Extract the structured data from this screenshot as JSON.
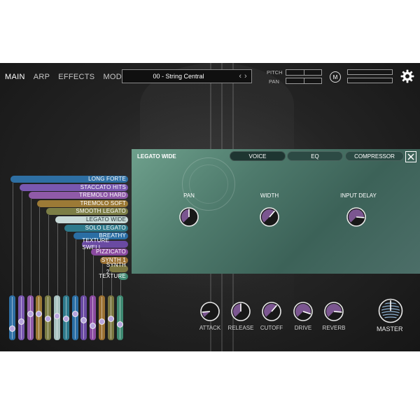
{
  "nav": {
    "tabs": [
      "MAIN",
      "ARP",
      "EFFECTS",
      "MOD"
    ],
    "active": "MAIN"
  },
  "preset": {
    "name": "00 - String Central",
    "prev_icon": "chevron-left-icon",
    "next_icon": "chevron-right-icon"
  },
  "global": {
    "pitch_label": "PITCH",
    "pan_label": "PAN",
    "m_button_label": "M",
    "settings_icon": "gear-icon"
  },
  "articulations": [
    {
      "label": "LONG FORTE",
      "color": "#2e6fa3"
    },
    {
      "label": "STACCATO HITS",
      "color": "#7a58b0"
    },
    {
      "label": "TREMOLO HARD",
      "color": "#8f5aa8"
    },
    {
      "label": "TREMOLO SOFT",
      "color": "#9c7a36"
    },
    {
      "label": "SMOOTH LEGATO",
      "color": "#7c7e46"
    },
    {
      "label": "LEGATO WIDE",
      "color": "#a8c2c0"
    },
    {
      "label": "SOLO LEGATO",
      "color": "#2e7a8c"
    },
    {
      "label": "BREATHY",
      "color": "#2a6ea4"
    },
    {
      "label": "TEXTURE SWELL",
      "color": "#6a4aa2"
    },
    {
      "label": "PIZZICATO",
      "color": "#8a4aa0"
    },
    {
      "label": "SYNTH 1",
      "color": "#9a7032"
    },
    {
      "label": "SYNTH 2",
      "color": "#7a7640"
    },
    {
      "label": "TEXTURE",
      "color": "#3f8a72"
    }
  ],
  "articulation_selected": "LEGATO WIDE",
  "slider_levels": [
    0.22,
    0.4,
    0.62,
    0.62,
    0.48,
    0.55,
    0.48,
    0.62,
    0.44,
    0.28,
    0.4,
    0.48,
    0.33
  ],
  "panel": {
    "title": "LEGATO WIDE",
    "tabs": [
      "VOICE",
      "EQ",
      "COMPRESSOR"
    ],
    "active_tab": "VOICE",
    "close_icon": "close-icon",
    "knobs": [
      {
        "label": "PAN",
        "value": 0.5
      },
      {
        "label": "WIDTH",
        "value": 0.65
      },
      {
        "label": "INPUT DELAY",
        "value": 0.85
      }
    ]
  },
  "envelope": {
    "knobs": [
      {
        "label": "ATTACK",
        "value": 0.15
      },
      {
        "label": "RELEASE",
        "value": 0.5
      },
      {
        "label": "CUTOFF",
        "value": 0.65
      },
      {
        "label": "DRIVE",
        "value": 0.9
      },
      {
        "label": "REVERB",
        "value": 0.85
      }
    ],
    "master_label": "MASTER"
  }
}
